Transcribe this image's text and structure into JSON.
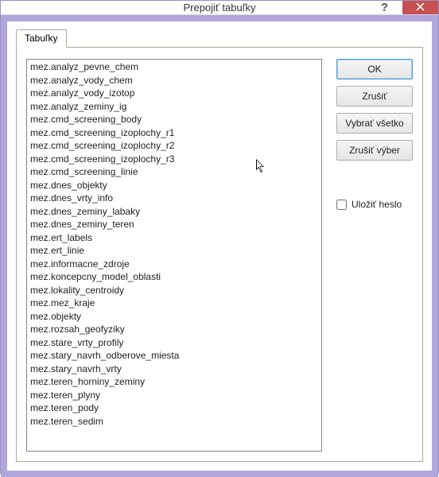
{
  "window": {
    "title": "Prepojiť tabuľky",
    "help_label": "?",
    "close_label": "✕"
  },
  "tabs": [
    {
      "label": "Tabuľky"
    }
  ],
  "buttons": {
    "ok": "OK",
    "cancel": "Zrušiť",
    "select_all": "Vybrať všetko",
    "deselect": "Zrušiť výber"
  },
  "save_password_label": "Uložiť heslo",
  "tables": [
    "mez.analyz_pevne_chem",
    "mez.analyz_vody_chem",
    "mez.analyz_vody_izotop",
    "mez.analyz_zeminy_ig",
    "mez.cmd_screening_body",
    "mez.cmd_screening_izoplochy_r1",
    "mez.cmd_screening_izoplochy_r2",
    "mez.cmd_screening_izoplochy_r3",
    "mez.cmd_screening_linie",
    "mez.dnes_objekty",
    "mez.dnes_vrty_info",
    "mez.dnes_zeminy_labaky",
    "mez.dnes_zeminy_teren",
    "mez.ert_labels",
    "mez.ert_linie",
    "mez.informacne_zdroje",
    "mez.koncepcny_model_oblasti",
    "mez.lokality_centroidy",
    "mez.mez_kraje",
    "mez.objekty",
    "mez.rozsah_geofyziky",
    "mez.stare_vrty_profily",
    "mez.stary_navrh_odberove_miesta",
    "mez.stary_navrh_vrty",
    "mez.teren_horniny_zeminy",
    "mez.teren_plyny",
    "mez.teren_pody",
    "mez.teren_sedim"
  ]
}
